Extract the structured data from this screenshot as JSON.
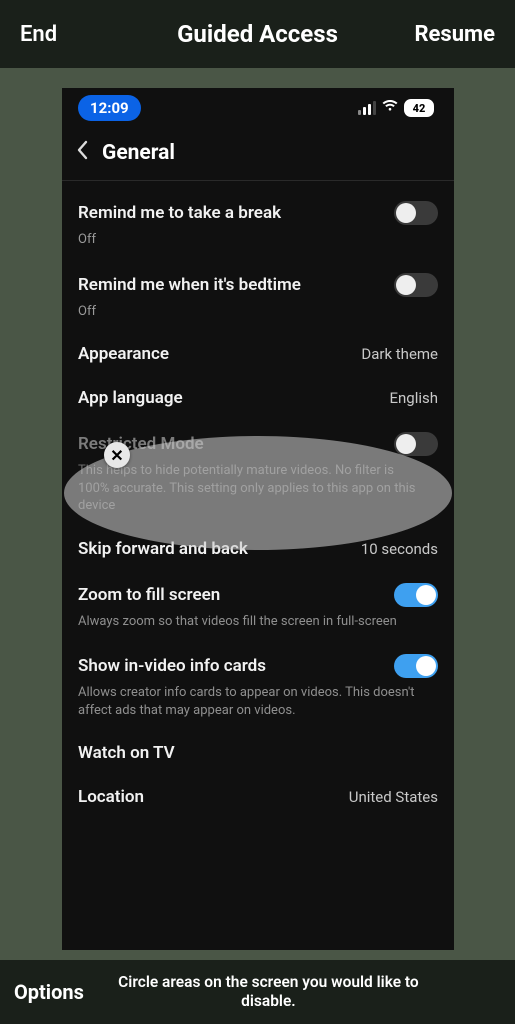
{
  "guided_access": {
    "end": "End",
    "title": "Guided Access",
    "resume": "Resume",
    "options": "Options",
    "hint": "Circle areas on the screen you would like to disable."
  },
  "status": {
    "time": "12:09",
    "battery": "42"
  },
  "nav": {
    "title": "General"
  },
  "rows": {
    "break": {
      "label": "Remind me to take a break",
      "sub": "Off"
    },
    "bedtime": {
      "label": "Remind me when it's bedtime",
      "sub": "Off"
    },
    "appearance": {
      "label": "Appearance",
      "value": "Dark theme"
    },
    "language": {
      "label": "App language",
      "value": "English"
    },
    "restricted": {
      "label": "Restricted Mode",
      "desc": "This helps to hide potentially mature videos. No filter is 100% accurate. This setting only applies to this app on this device"
    },
    "skip": {
      "label": "Skip forward and back",
      "value": "10 seconds"
    },
    "zoom": {
      "label": "Zoom to fill screen",
      "desc": "Always zoom so that videos fill the screen in full-screen"
    },
    "infocards": {
      "label": "Show in-video info cards",
      "desc": "Allows creator info cards to appear on videos. This doesn't affect ads that may appear on videos."
    },
    "watchtv": {
      "label": "Watch on TV"
    },
    "location": {
      "label": "Location",
      "value": "United States"
    }
  }
}
